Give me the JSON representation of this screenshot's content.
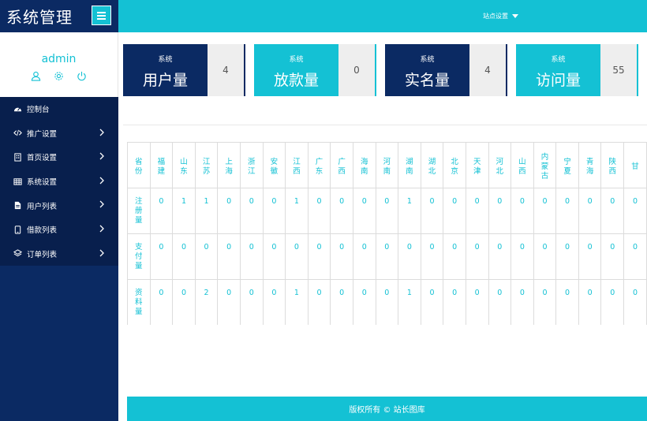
{
  "app": {
    "title": "系统管理"
  },
  "profile": {
    "name": "admin",
    "icons": [
      "user-icon",
      "gear-icon",
      "power-icon"
    ]
  },
  "topbar": {
    "site_settings": "站点设置"
  },
  "nav": {
    "items": [
      {
        "label": "控制台",
        "icon": "dashboard-icon",
        "chevron": false
      },
      {
        "label": "推广设置",
        "icon": "code-icon",
        "chevron": true
      },
      {
        "label": "首页设置",
        "icon": "building-icon",
        "chevron": true
      },
      {
        "label": "系统设置",
        "icon": "table-icon",
        "chevron": true
      },
      {
        "label": "用户列表",
        "icon": "file-icon",
        "chevron": true
      },
      {
        "label": "借款列表",
        "icon": "phone-icon",
        "chevron": true
      },
      {
        "label": "订单列表",
        "icon": "layers-icon",
        "chevron": true
      }
    ]
  },
  "cards": [
    {
      "small": "系统",
      "big": "用户量",
      "value": "4",
      "style": "dark"
    },
    {
      "small": "系统",
      "big": "放款量",
      "value": "0",
      "style": "cyan"
    },
    {
      "small": "系统",
      "big": "实名量",
      "value": "4",
      "style": "dark"
    },
    {
      "small": "系统",
      "big": "访问量",
      "value": "55",
      "style": "cyan"
    }
  ],
  "table": {
    "header_label": "省份",
    "provinces": [
      "福建",
      "山东",
      "江苏",
      "上海",
      "浙江",
      "安徽",
      "江西",
      "广东",
      "广西",
      "海南",
      "河南",
      "湖南",
      "湖北",
      "北京",
      "天津",
      "河北",
      "山西",
      "内蒙古",
      "宁夏",
      "青海",
      "陕西",
      "甘"
    ],
    "rows": [
      {
        "label": "注册量",
        "values": [
          "0",
          "1",
          "1",
          "0",
          "0",
          "0",
          "1",
          "0",
          "0",
          "0",
          "0",
          "1",
          "0",
          "0",
          "0",
          "0",
          "0",
          "0",
          "0",
          "0",
          "0",
          "0"
        ]
      },
      {
        "label": "支付量",
        "values": [
          "0",
          "0",
          "0",
          "0",
          "0",
          "0",
          "0",
          "0",
          "0",
          "0",
          "0",
          "0",
          "0",
          "0",
          "0",
          "0",
          "0",
          "0",
          "0",
          "0",
          "0",
          "0"
        ]
      },
      {
        "label": "资料量",
        "values": [
          "0",
          "0",
          "2",
          "0",
          "0",
          "0",
          "1",
          "0",
          "0",
          "0",
          "0",
          "1",
          "0",
          "0",
          "0",
          "0",
          "0",
          "0",
          "0",
          "0",
          "0",
          "0"
        ]
      }
    ]
  },
  "footer": {
    "text": "版权所有 © 站长图库"
  },
  "colors": {
    "navy": "#0b2a63",
    "cyan": "#14c1d4",
    "card_value_bg": "#eeeeee"
  }
}
